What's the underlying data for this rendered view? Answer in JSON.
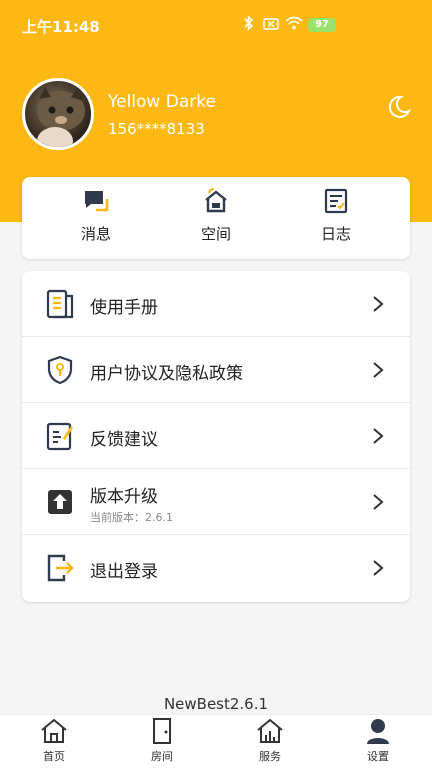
{
  "status_bar": {
    "time": "上午11:48",
    "battery": "97"
  },
  "profile": {
    "name": "Yellow Darke",
    "phone": "156****8133"
  },
  "quick_actions": [
    {
      "label": "消息",
      "icon": "message-icon"
    },
    {
      "label": "空间",
      "icon": "home-space-icon"
    },
    {
      "label": "日志",
      "icon": "log-icon"
    }
  ],
  "menu": [
    {
      "label": "使用手册",
      "icon": "manual-icon"
    },
    {
      "label": "用户协议及隐私政策",
      "icon": "shield-key-icon"
    },
    {
      "label": "反馈建议",
      "icon": "feedback-icon"
    },
    {
      "label": "版本升级",
      "sub": "当前版本：2.6.1",
      "icon": "upgrade-icon"
    },
    {
      "label": "退出登录",
      "icon": "logout-icon"
    }
  ],
  "footer_version": "NewBest2.6.1",
  "tabs": [
    {
      "label": "首页",
      "icon": "home-icon"
    },
    {
      "label": "房间",
      "icon": "door-icon"
    },
    {
      "label": "服务",
      "icon": "service-icon"
    },
    {
      "label": "设置",
      "icon": "user-icon",
      "active": true
    }
  ],
  "colors": {
    "accent": "#fdb813",
    "icon_dark": "#2f3a4f"
  }
}
